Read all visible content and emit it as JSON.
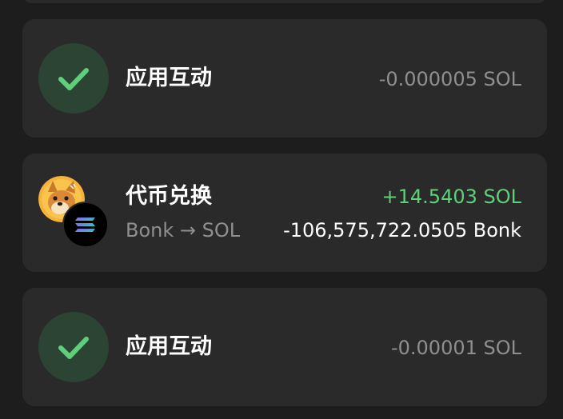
{
  "transactions": [
    {
      "type": "app_interaction",
      "title": "应用互动",
      "icon": "check-icon",
      "amount": "-0.000005 SOL",
      "amount_color": "#8f8f8f"
    },
    {
      "type": "token_swap",
      "title": "代币兑换",
      "from_token_icon": "bonk-token-icon",
      "to_token_icon": "solana-token-icon",
      "pair": "Bonk → SOL",
      "amount_in": "+14.5403 SOL",
      "amount_in_color": "#5fd07a",
      "amount_out": "-106,575,722.0505 Bonk",
      "amount_out_color": "#ffffff"
    },
    {
      "type": "app_interaction",
      "title": "应用互动",
      "icon": "check-icon",
      "amount": "-0.00001 SOL",
      "amount_color": "#8f8f8f"
    }
  ],
  "colors": {
    "background": "#1d1d1d",
    "card": "#2a2a2a",
    "success_circle": "#2b4434",
    "success_check": "#5fd07a"
  }
}
